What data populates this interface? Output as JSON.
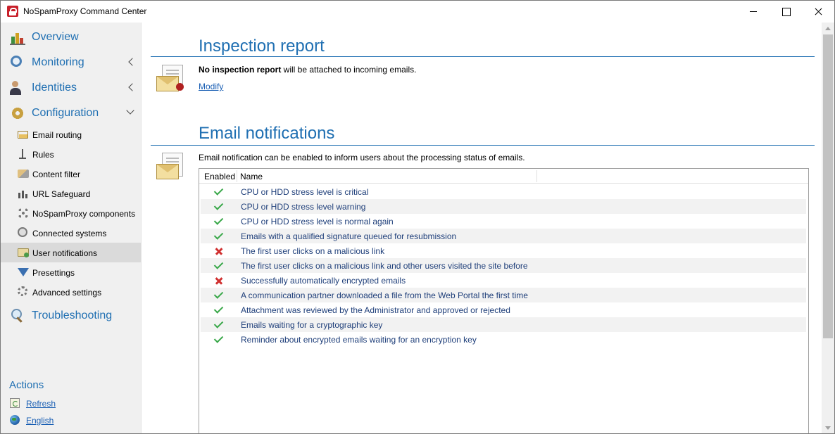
{
  "window": {
    "title": "NoSpamProxy Command Center"
  },
  "sidebar": {
    "nav": [
      {
        "label": "Overview",
        "icon": "overview-icon"
      },
      {
        "label": "Monitoring",
        "icon": "monitoring-icon"
      },
      {
        "label": "Identities",
        "icon": "identities-icon"
      },
      {
        "label": "Configuration",
        "icon": "configuration-icon"
      }
    ],
    "config_items": [
      {
        "label": "Email routing",
        "icon": "email-routing-icon"
      },
      {
        "label": "Rules",
        "icon": "rules-icon"
      },
      {
        "label": "Content filter",
        "icon": "content-filter-icon"
      },
      {
        "label": "URL Safeguard",
        "icon": "url-safeguard-icon"
      },
      {
        "label": "NoSpamProxy components",
        "icon": "components-icon"
      },
      {
        "label": "Connected systems",
        "icon": "connected-systems-icon"
      },
      {
        "label": "User notifications",
        "icon": "user-notifications-icon",
        "selected": true
      },
      {
        "label": "Presettings",
        "icon": "presettings-icon"
      },
      {
        "label": "Advanced settings",
        "icon": "advanced-settings-icon"
      }
    ],
    "troubleshooting": {
      "label": "Troubleshooting",
      "icon": "troubleshooting-icon"
    },
    "actions": {
      "title": "Actions",
      "items": [
        {
          "label": "Refresh",
          "icon": "refresh-icon"
        },
        {
          "label": "English",
          "icon": "globe-icon"
        }
      ]
    }
  },
  "main": {
    "inspection": {
      "title": "Inspection report",
      "bold_text": "No inspection report",
      "rest_text": " will be attached to incoming emails.",
      "modify_label": "Modify"
    },
    "notifications": {
      "title": "Email notifications",
      "description": "Email notification can be enabled to inform users about the processing status of emails.",
      "columns": [
        "Enabled",
        "Name"
      ],
      "rows": [
        {
          "enabled": true,
          "name": "CPU or HDD stress level is critical"
        },
        {
          "enabled": true,
          "name": "CPU or HDD stress level warning"
        },
        {
          "enabled": true,
          "name": "CPU or HDD stress level is normal again"
        },
        {
          "enabled": true,
          "name": "Emails with a qualified signature queued for resubmission"
        },
        {
          "enabled": false,
          "name": "The first user clicks on a malicious link"
        },
        {
          "enabled": true,
          "name": "The first user clicks on a malicious link and other users visited the site before"
        },
        {
          "enabled": false,
          "name": "Successfully automatically encrypted emails"
        },
        {
          "enabled": true,
          "name": "A communication partner downloaded a file from the Web Portal the first time"
        },
        {
          "enabled": true,
          "name": "Attachment was reviewed by the Administrator and approved or rejected"
        },
        {
          "enabled": true,
          "name": "Emails waiting for a cryptographic key"
        },
        {
          "enabled": true,
          "name": "Reminder about encrypted emails waiting for an encryption key"
        }
      ]
    }
  },
  "colors": {
    "accent": "#1f6fb2",
    "enabled_check": "#3aa84a",
    "disabled_cross": "#d03030",
    "selected_bg": "#dadada"
  }
}
